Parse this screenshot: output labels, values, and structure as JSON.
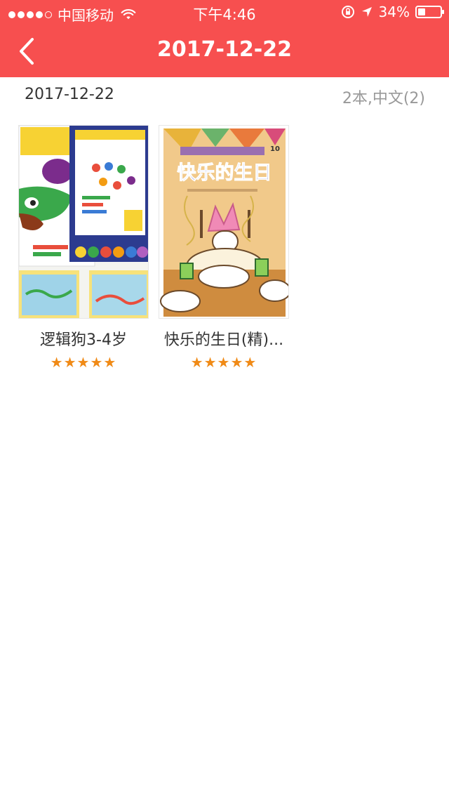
{
  "status_bar": {
    "carrier": "中国移动",
    "time": "下午4:46",
    "battery": "34%",
    "battery_level": 0.34
  },
  "header": {
    "title": "2017-12-22",
    "back_icon": "chevron-left-icon"
  },
  "subheader": {
    "date": "2017-12-22",
    "summary": "2本,中文(2)"
  },
  "books": [
    {
      "title": "逻辑狗3-4岁",
      "rating": 5,
      "stars": "★★★★★"
    },
    {
      "title": "快乐的生日(精)...",
      "rating": 5,
      "stars": "★★★★★",
      "cover_title": "快乐的生日",
      "cover_number": "10"
    }
  ],
  "colors": {
    "header_bg": "#f74f4f",
    "star": "#f08a16"
  }
}
